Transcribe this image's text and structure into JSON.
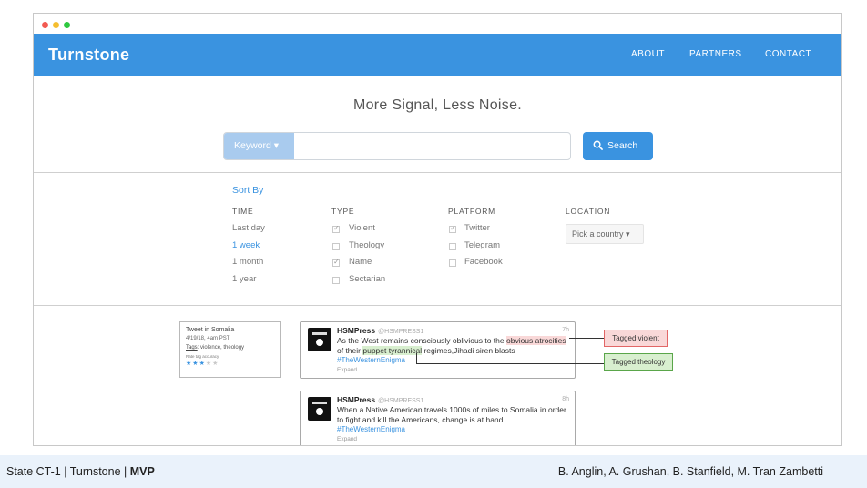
{
  "nav": {
    "brand": "Turnstone",
    "links": [
      "ABOUT",
      "PARTNERS",
      "CONTACT"
    ],
    "bg_color": "#3a93e0"
  },
  "hero": {
    "title": "More Signal, Less Noise.",
    "keyword_button": "Keyword ▾",
    "search_value": "",
    "search_button": "Search"
  },
  "sort": {
    "label": "Sort By",
    "time": {
      "header": "TIME",
      "options": [
        "Last day",
        "1 week",
        "1 month",
        "1 year"
      ],
      "selected": "1 week"
    },
    "type": {
      "header": "TYPE",
      "options": [
        {
          "label": "Violent",
          "checked": true
        },
        {
          "label": "Theology",
          "checked": false
        },
        {
          "label": "Name",
          "checked": true
        },
        {
          "label": "Sectarian",
          "checked": false
        }
      ]
    },
    "platform": {
      "header": "PLATFORM",
      "options": [
        {
          "label": "Twitter",
          "checked": true
        },
        {
          "label": "Telegram",
          "checked": false
        },
        {
          "label": "Facebook",
          "checked": false
        }
      ]
    },
    "location": {
      "header": "LOCATION",
      "placeholder": "Pick a country ▾"
    }
  },
  "summary_card": {
    "title": "Tweet in Somalia",
    "date": "4/19/18, 4am PST",
    "tags_label": "Tags",
    "tags_value": ": violence, theology",
    "rate_label": "Rate tag accuracy",
    "rating": 3,
    "rating_max": 5
  },
  "tweets": [
    {
      "user": "HSMPress",
      "handle": "@HSMPRESS1",
      "time": "7h",
      "text_before_red": "As the West remains consciously oblivious to the ",
      "text_red": "obvious atrocities",
      "text_before_green": " of their ",
      "text_green": "puppet tyrannical",
      "text_after": " regimes,Jihadi siren blasts",
      "hashtag": "#TheWesternEnigma",
      "expand": "Expand"
    },
    {
      "user": "HSMPress",
      "handle": "@HSMPRESS1",
      "time": "8h",
      "text": "When a Native American travels 1000s of miles to Somalia in order to fight and kill the Americans, change is at hand",
      "hashtag": "#TheWesternEnigma",
      "expand": "Expand"
    }
  ],
  "tags": {
    "violent": "Tagged violent",
    "theology": "Tagged theology",
    "violent_color": "#f9d8d8",
    "theology_color": "#d8efcf"
  },
  "footer": {
    "left_prefix": "State CT-1 | Turnstone | ",
    "left_bold": "MVP",
    "right": "B. Anglin, A. Grushan, B. Stanfield, M. Tran Zambetti"
  }
}
